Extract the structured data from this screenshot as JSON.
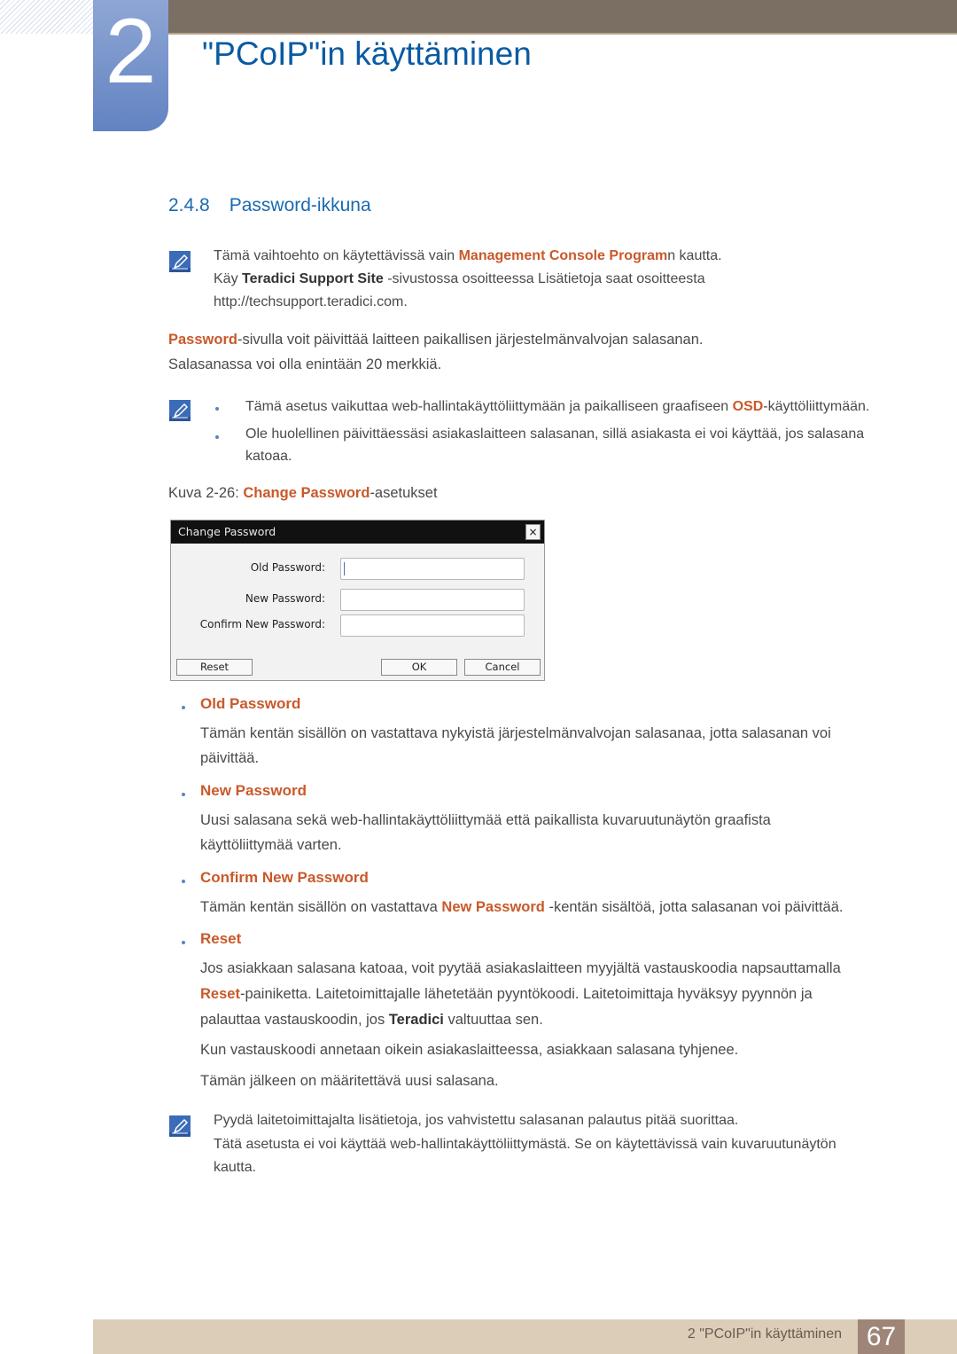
{
  "header": {
    "chapter_number": "2",
    "chapter_title": "\"PCoIP\"in käyttäminen"
  },
  "section": {
    "number": "2.4.8",
    "title": "Password-ikkuna"
  },
  "note1": {
    "icon": "note-pencil-icon",
    "line1_pre": "Tämä vaihtoehto on käytettävissä vain ",
    "line1_highlight": "Management Console Program",
    "line1_post": "n kautta.",
    "line2_pre": "Käy ",
    "line2_bold": "Teradici Support Site",
    "line2_post": " -sivustossa osoitteessa Lisätietoja saat osoitteesta",
    "line3": "http://techsupport.teradici.com."
  },
  "intro": {
    "highlight": "Password",
    "line1_post": "-sivulla voit päivittää laitteen paikallisen järjestelmänvalvojan salasanan.",
    "line2": "Salasanassa voi olla enintään 20 merkkiä."
  },
  "note2": {
    "icon": "note-pencil-icon",
    "bullet1_pre": "Tämä asetus vaikuttaa web-hallintakäyttöliittymään ja paikalliseen graafiseen ",
    "bullet1_highlight": "OSD",
    "bullet1_post": "-käyttöliittymään.",
    "bullet2_line1": "Ole huolellinen päivittäessäsi asiakaslaitteen salasanan, sillä asiakasta ei voi käyttää, jos salasana",
    "bullet2_line2": "katoaa."
  },
  "figure": {
    "caption_pre": "Kuva 2-26: ",
    "caption_highlight": "Change Password",
    "caption_post": "-asetukset"
  },
  "dialog": {
    "title": "Change Password",
    "close_icon": "×",
    "fields": [
      {
        "label": "Old Password:",
        "value": ""
      },
      {
        "label": "New Password:",
        "value": ""
      },
      {
        "label": "Confirm New Password:",
        "value": ""
      }
    ],
    "buttons": {
      "reset": "Reset",
      "ok": "OK",
      "cancel": "Cancel"
    }
  },
  "items": {
    "old_password": {
      "title": "Old Password",
      "line1": "Tämän kentän sisällön on vastattava nykyistä järjestelmänvalvojan salasanaa, jotta salasanan voi",
      "line2": "päivittää."
    },
    "new_password": {
      "title": "New Password",
      "line1": "Uusi salasana sekä web-hallintakäyttöliittymää että paikallista kuvaruutunäytön graafista",
      "line2": "käyttöliittymää varten."
    },
    "confirm_password": {
      "title": "Confirm New Password",
      "pre": "Tämän kentän sisällön on vastattava ",
      "highlight": "New Password",
      "post": " -kentän sisältöä, jotta salasanan voi päivittää."
    },
    "reset": {
      "title": "Reset",
      "line1": "Jos asiakkaan salasana katoaa, voit pyytää asiakaslaitteen myyjältä vastauskoodia napsauttamalla",
      "line2_highlight": "Reset",
      "line2_post": "-painiketta. Laitetoimittajalle lähetetään pyyntökoodi. Laitetoimittaja hyväksyy pyynnön ja",
      "line3_pre": "palauttaa vastauskoodin, jos ",
      "line3_bold": "Teradici",
      "line3_post": " valtuuttaa sen.",
      "para2": "Kun vastauskoodi annetaan oikein asiakaslaitteessa, asiakkaan salasana tyhjenee.",
      "para3": "Tämän jälkeen on määritettävä uusi salasana."
    }
  },
  "note3": {
    "icon": "note-pencil-icon",
    "line1": "Pyydä laitetoimittajalta lisätietoja, jos vahvistettu salasanan palautus pitää suorittaa.",
    "line2": "Tätä asetusta ei voi käyttää web-hallintakäyttöliittymästä. Se on käytettävissä vain kuvaruutunäytön",
    "line3": "kautta."
  },
  "footer": {
    "chapter_label": "2 \"PCoIP\"in käyttäminen",
    "page_number": "67"
  },
  "colors": {
    "accent_orange": "#c9592a",
    "heading_blue": "#1a6ab0",
    "tab_blue": "#6283c2",
    "top_bar_brown": "#7b6e62",
    "footer_beige": "#dccdb9",
    "page_box": "#9e8578"
  }
}
